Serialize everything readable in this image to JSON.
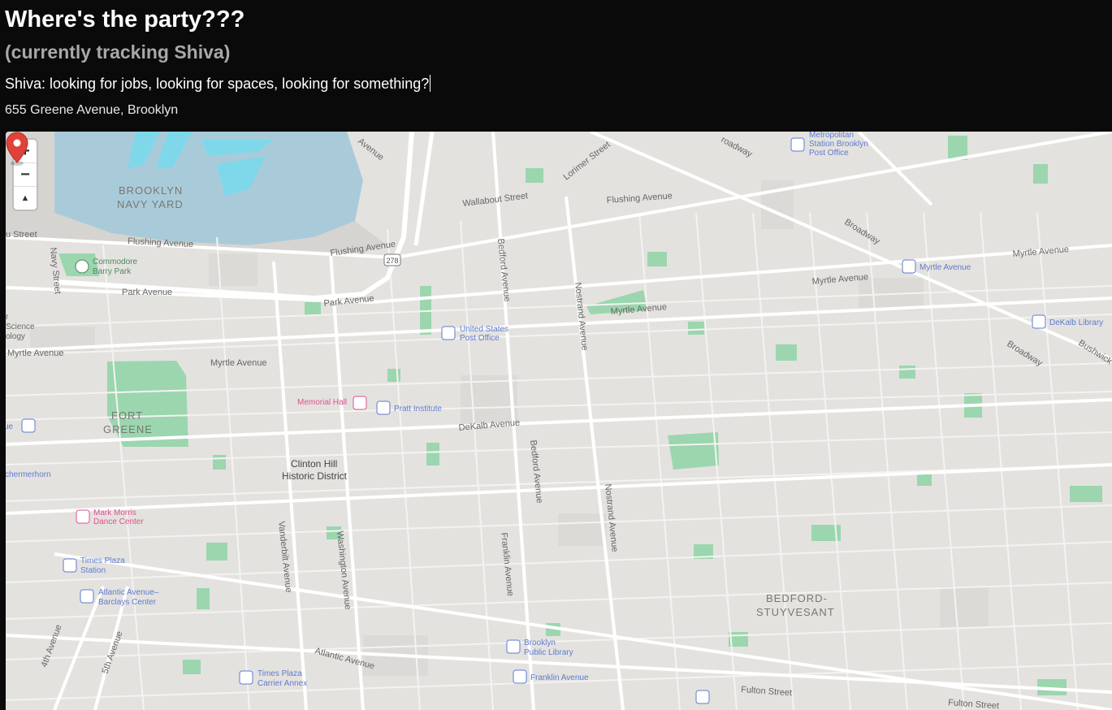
{
  "header": {
    "title": "Where's the party???",
    "subtitle": "(currently tracking Shiva)",
    "status": "Shiva: looking for jobs, looking for spaces, looking for something?",
    "address": "655 Greene Avenue, Brooklyn"
  },
  "map": {
    "controls": {
      "zoom_in": "+",
      "zoom_out": "−",
      "compass": "▲"
    },
    "colors": {
      "land": "#e4e2df",
      "water": "#a9cbd9",
      "park": "#93d4a8",
      "road": "#ffffff",
      "marker": "#e0423a",
      "poi_blue": "#5d7bd0",
      "poi_pink": "#e0508e"
    },
    "areas": {
      "navy_yard_1": "BROOKLYN",
      "navy_yard_2": "NAVY YARD",
      "fort_greene_1": "FORT",
      "fort_greene_2": "GREENE",
      "bedstuy_1": "BEDFORD-",
      "bedstuy_2": "STUYVESANT",
      "clinton_hill_1": "Clinton Hill",
      "clinton_hill_2": "Historic District"
    },
    "streets": {
      "flushing_w": "Flushing Avenue",
      "flushing_mid": "Flushing Avenue",
      "flushing_e": "Flushing Avenue",
      "park_w": "Park Avenue",
      "park_e": "Park Avenue",
      "myrtle_w": "Myrtle Avenue",
      "myrtle_w2": "Myrtle Avenue",
      "myrtle_mid": "Myrtle Avenue",
      "myrtle_e": "Myrtle Avenue",
      "myrtle_far": "Myrtle Avenue",
      "dekalb": "DeKalb Avenue",
      "wallabout": "Wallabout Street",
      "lorimer": "Lorimer Street",
      "broadway_n": "Broadway",
      "broadway_mid": "Broadway",
      "broadway_s": "Broadway",
      "bushwick": "Bushwick",
      "bedford_n": "Bedford Avenue",
      "bedford_s": "Bedford Avenue",
      "nostrand_n": "Nostrand Avenue",
      "nostrand_s": "Nostrand Avenue",
      "franklin": "Franklin Avenue",
      "vanderbilt": "Vanderbilt Avenue",
      "washington": "Washington Avenue",
      "atlantic": "Atlantic Avenue",
      "fulton_mid": "Fulton Street",
      "fulton_e": "Fulton Street",
      "fourth": "4th Avenue",
      "fifth": "5th Avenue",
      "navy_st": "Navy Street",
      "kent_frag": "Avenue",
      "u_street": "u Street",
      "route": "278",
      "ue_frag": "ue",
      "schermerhorn": "chermerhorn",
      "broadway_top": "roadway"
    },
    "pois": {
      "commodore_1": "Commodore",
      "commodore_2": "Barry Park",
      "usps_1": "United States",
      "usps_2": "Post Office",
      "memorial_hall": "Memorial Hall",
      "pratt": "Pratt Institute",
      "metro_1": "Metropolitan",
      "metro_2": "Station Brooklyn",
      "metro_3": "Post Office",
      "myrtle_station": "Myrtle Avenue",
      "dekalb_lib": "DeKalb Library",
      "mark_morris_1": "Mark Morris",
      "mark_morris_2": "Dance Center",
      "times_plaza_1": "Times Plaza",
      "times_plaza_2": "Station",
      "atlantic_1": "Atlantic Avenue–",
      "atlantic_2": "Barclays Center",
      "bpl_1": "Brooklyn",
      "bpl_2": "Public Library",
      "franklin_station": "Franklin Avenue",
      "times_annex_1": "Times Plaza",
      "times_annex_2": "Carrier Annex",
      "science_1": "r",
      "science_2": "Science",
      "science_3": "ology"
    }
  }
}
